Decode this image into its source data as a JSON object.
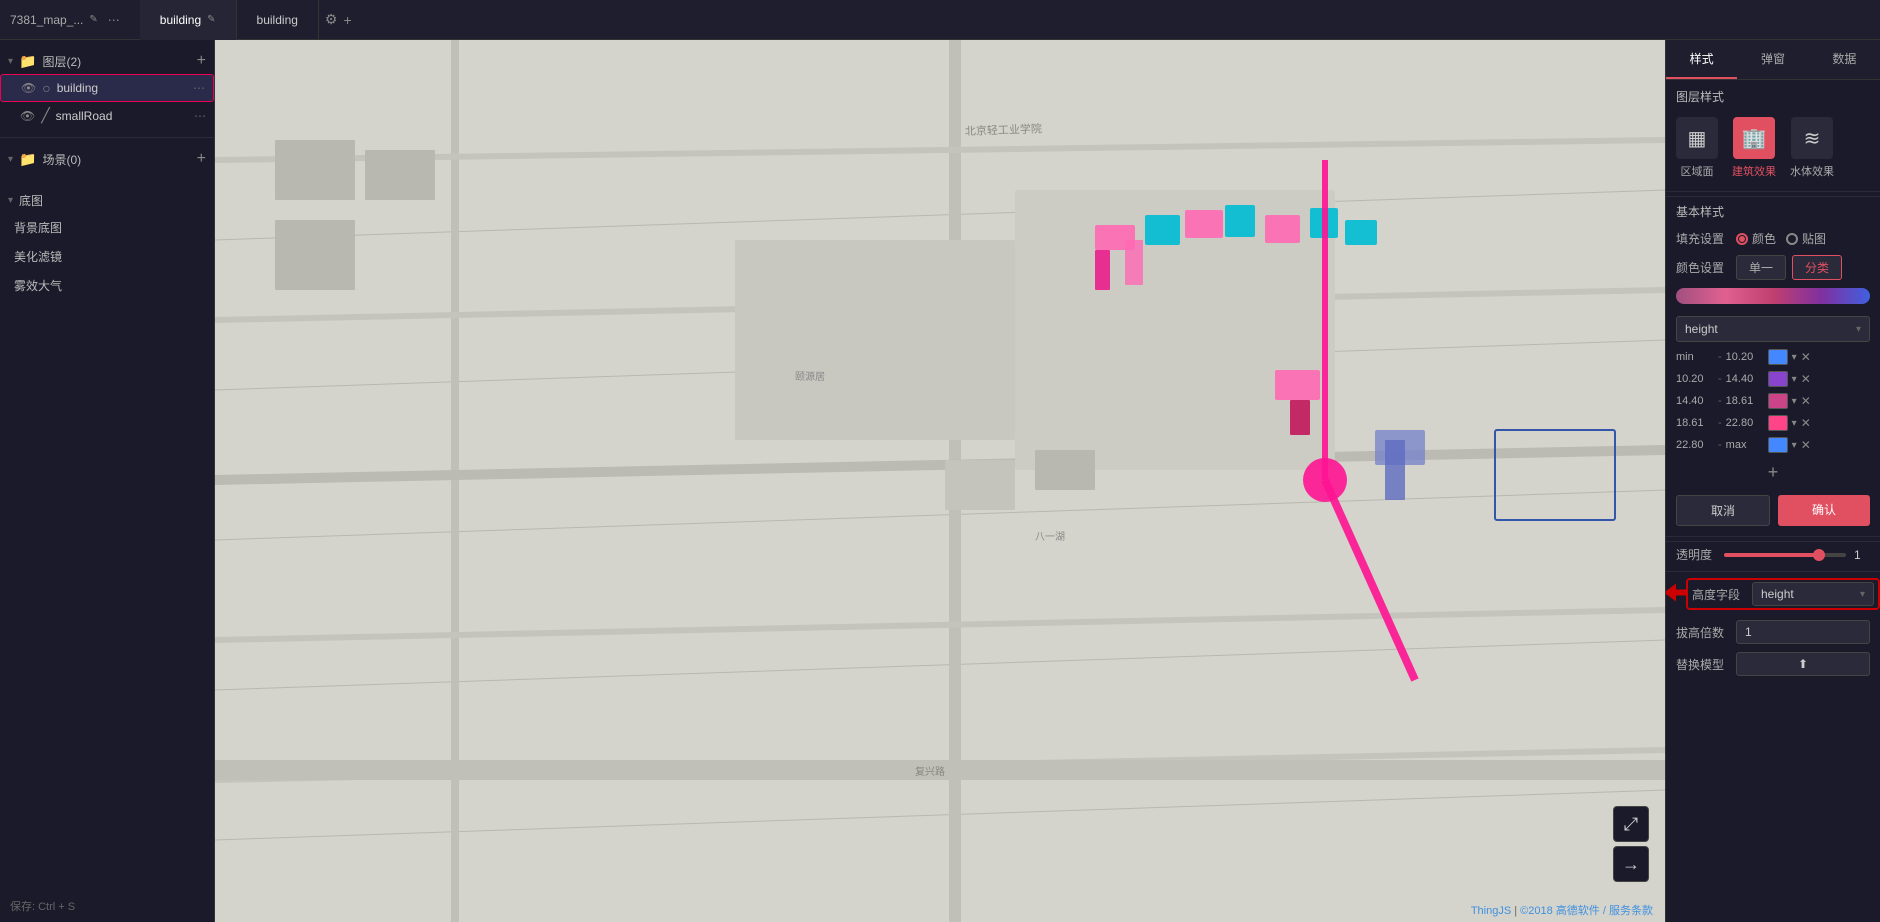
{
  "topbar": {
    "file_name": "7381_map_...",
    "edit_icon": "✎",
    "menu_icon": "⋯",
    "tabs": [
      {
        "label": "building",
        "active": true,
        "icon": "✎",
        "close": "✕"
      },
      {
        "label": "building",
        "active": false
      }
    ],
    "settings_icon": "⚙",
    "add_icon": "+"
  },
  "sidebar": {
    "layers_title": "图层(2)",
    "layers_add": "+",
    "layers": [
      {
        "name": "building",
        "icon": "○",
        "type": "polygon",
        "selected": true
      },
      {
        "name": "smallRoad",
        "icon": "/",
        "type": "line",
        "selected": false
      }
    ],
    "scenes_title": "场景(0)",
    "scenes_add": "+",
    "basemap_title": "底图",
    "basemap_items": [
      "背景底图",
      "美化滤镜",
      "雾效大气"
    ],
    "save_hint": "保存: Ctrl + S"
  },
  "panel": {
    "tabs": [
      "样式",
      "弹窗",
      "数据"
    ],
    "active_tab": "样式",
    "section_title": "图层样式",
    "style_icons": [
      {
        "label": "区域面",
        "icon": "▦",
        "active": false
      },
      {
        "label": "建筑效果",
        "icon": "🏢",
        "active": true
      },
      {
        "label": "水体效果",
        "icon": "≋",
        "active": false
      }
    ],
    "basic_style_title": "基本样式",
    "fill_label": "填充设置",
    "fill_options": [
      {
        "label": "颜色",
        "checked": true
      },
      {
        "label": "贴图",
        "checked": false
      }
    ],
    "color_label": "颜色设置",
    "color_options": [
      "单一",
      "分类"
    ],
    "active_color_option": "单一",
    "height_dropdown_label": "height",
    "ranges": [
      {
        "from": "min",
        "to": "10.20",
        "color": "#4488ff"
      },
      {
        "from": "10.20",
        "to": "14.40",
        "color": "#8844cc"
      },
      {
        "from": "14.40",
        "to": "18.61",
        "color": "#cc4488"
      },
      {
        "from": "18.61",
        "to": "22.80",
        "color": "#ff4488"
      },
      {
        "from": "22.80",
        "to": "max",
        "color": "#4488ff"
      }
    ],
    "add_range_btn": "+",
    "cancel_btn": "取消",
    "confirm_btn": "确认",
    "opacity_label": "透明度",
    "opacity_value": "1",
    "height_field_label": "高度字段",
    "height_field_value": "height",
    "multiplier_label": "拔高倍数",
    "multiplier_value": "1",
    "replace_model_label": "替换模型",
    "replace_model_icon": "⬆"
  },
  "bottombar": {
    "save_hint": "保存: Ctrl + S",
    "thingjs": "ThingJS",
    "separator": " | ",
    "gaode": "©2018 高德软件",
    "service": "/ 服务条款"
  },
  "mapnav": {
    "expand_icon": "⤢",
    "next_icon": "→"
  }
}
